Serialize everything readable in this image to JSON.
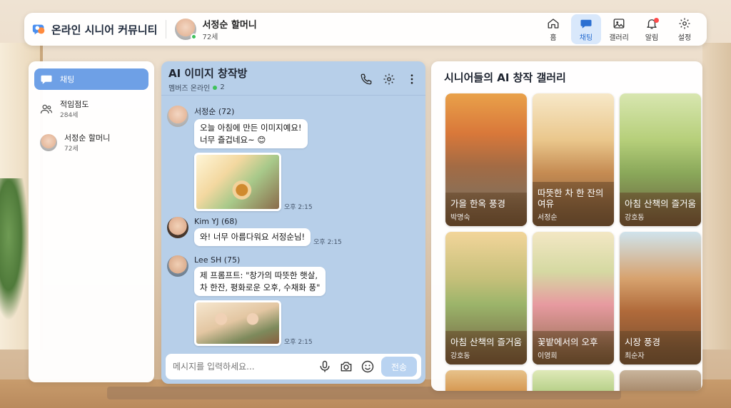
{
  "app": {
    "title": "온라인 시니어 커뮤니티"
  },
  "user": {
    "name": "서정순 할머니",
    "age": "72세"
  },
  "nav": [
    {
      "label": "홈",
      "icon": "home-icon"
    },
    {
      "label": "채팅",
      "icon": "chat-icon",
      "active": true
    },
    {
      "label": "갤러리",
      "icon": "gallery-icon"
    },
    {
      "label": "알림",
      "icon": "bell-icon",
      "badge": true
    },
    {
      "label": "설정",
      "icon": "gear-icon"
    }
  ],
  "sidebar": {
    "items": [
      {
        "title": "채팅",
        "active": true
      },
      {
        "title": "적임점도",
        "sub": "284세"
      },
      {
        "title": "서정순 할머니",
        "sub": "72세"
      }
    ]
  },
  "chat": {
    "title": "AI 이미지 창작방",
    "members_label": "멤버즈 온라인",
    "members_count": "2",
    "messages": [
      {
        "sender": "서정순 (72)",
        "lines": [
          "오늘 아침에 만든 이미지예요!",
          "너무 즐겁네요~ 😊"
        ],
        "time": "오후 2:15"
      },
      {
        "sender": "Kim YJ (68)",
        "lines": [
          "와! 너무 아름다워요 서정순님!"
        ],
        "time": "오후 2:15"
      },
      {
        "sender": "Lee SH (75)",
        "lines": [
          "제 프롬프트: \"창가의 따뜻한 햇살,",
          "차 한잔, 평화로운 오후, 수채화 풍\""
        ],
        "time": "오후 2:15"
      }
    ],
    "input_placeholder": "메시지를 입력하세요...",
    "send_label": "전송"
  },
  "gallery": {
    "title": "시니어들의 AI 창작 갤러리",
    "cards": [
      {
        "title": "가을 한옥 풍경",
        "author": "박명숙"
      },
      {
        "title": "따뜻한 차 한 잔의 여유",
        "author": "서정순"
      },
      {
        "title": "아침 산책의 즐거움",
        "author": "강호동"
      },
      {
        "title": "아침 산책의 즐거움",
        "author": "강호동"
      },
      {
        "title": "꽃밭에서의 오후",
        "author": "이영희"
      },
      {
        "title": "시장 풍경",
        "author": "최순자"
      }
    ]
  },
  "colors": {
    "accent": "#2b6fd1",
    "chat_bg": "#b7cfe9",
    "online": "#3ec15a"
  }
}
